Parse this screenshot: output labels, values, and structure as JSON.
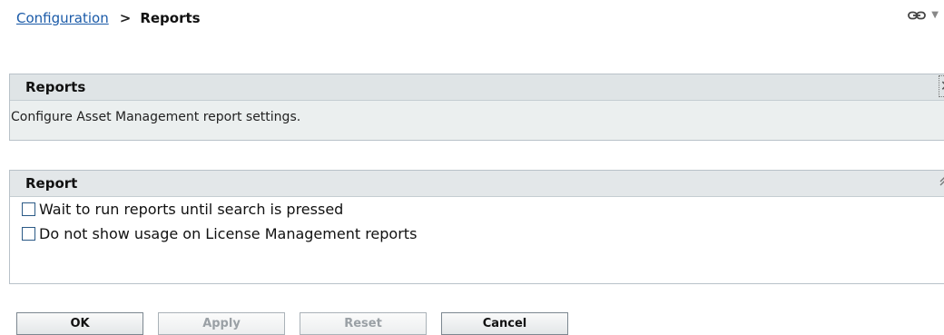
{
  "breadcrumb": {
    "parent_label": "Configuration",
    "separator": ">",
    "current_label": "Reports"
  },
  "top_icons": {
    "link_icon": "link-icon",
    "dropdown_glyph": "▼"
  },
  "info_panel": {
    "title": "Reports",
    "description": "Configure Asset Management report settings.",
    "close_glyph": "✕"
  },
  "report_panel": {
    "title": "Report",
    "collapse_glyph": "⌃",
    "options": [
      {
        "label": "Wait to run reports until search is pressed",
        "checked": false
      },
      {
        "label": "Do not show usage on License Management reports",
        "checked": false
      }
    ]
  },
  "buttons": {
    "ok": "OK",
    "apply": "Apply",
    "reset": "Reset",
    "cancel": "Cancel"
  },
  "colors": {
    "link": "#1a5aa8",
    "panel_header": "#dfe4e6",
    "panel_body": "#ebefef",
    "checkbox_border": "#2b5a86"
  }
}
